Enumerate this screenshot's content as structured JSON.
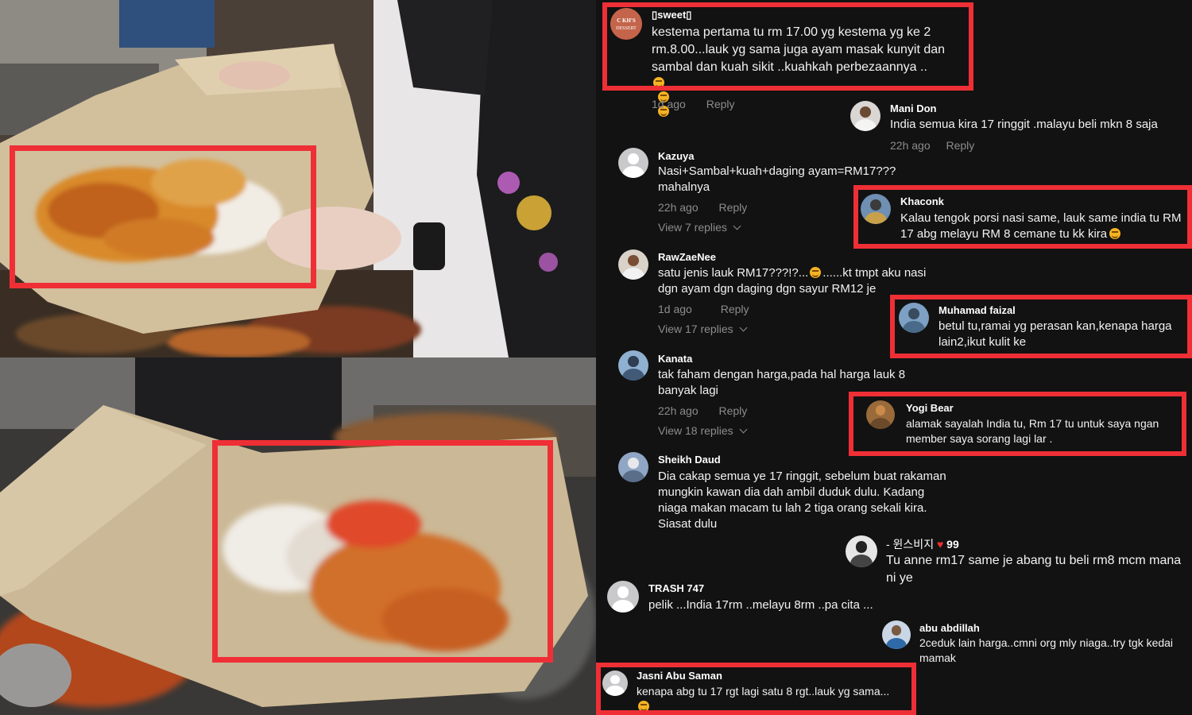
{
  "colors": {
    "highlight": "#ef2f36",
    "panel_bg": "#121212",
    "muted_text": "#8c8c8c"
  },
  "comments": [
    {
      "user": "⁠sweet⁠",
      "display_user": "▯sweet▯",
      "text": "kestema pertama tu rm 17.00 yg kestema yg ke 2 rm.8.00...lauk yg sama juga ayam masak kunyit dan sambal dan kuah sikit ..kuahkah perbezaannya ..",
      "time": "1d ago",
      "reply": "Reply",
      "avatar_icon": "dessert-logo-icon"
    },
    {
      "user": "Mani Don",
      "text": "India semua kira 17 ringgit .malayu beli mkn 8 saja",
      "time": "22h ago",
      "reply": "Reply"
    },
    {
      "user": "Kazuya",
      "text": "Nasi+Sambal+kuah+daging ayam=RM17??? mahalnya",
      "time": "22h ago",
      "reply": "Reply",
      "view": "View 7 replies"
    },
    {
      "user": "Khaconk",
      "text": "Kalau tengok porsi nasi same, lauk same india tu RM 17 abg melayu RM 8 cemane tu kk kira"
    },
    {
      "user": "RawZaeNee",
      "text_a": "satu jenis lauk RM17???!?...",
      "text_b": "......kt tmpt aku nasi dgn ayam dgn daging dgn sayur RM12 je",
      "time": "1d ago",
      "reply": "Reply",
      "view": "View 17 replies"
    },
    {
      "user": "Muhamad faizal",
      "text": "betul tu,ramai yg perasan kan,kenapa harga lain2,ikut kulit ke"
    },
    {
      "user": "Kanata",
      "text": "tak faham dengan harga,pada hal harga lauk 8 banyak lagi",
      "time": "22h ago",
      "reply": "Reply",
      "view": "View 18 replies"
    },
    {
      "user": "Yogi Bear",
      "text": "alamak sayalah India tu, Rm 17 tu untuk saya ngan member saya sorang lagi lar ."
    },
    {
      "user": "Sheikh Daud",
      "text": "Dia cakap semua ye 17 ringgit, sebelum buat rakaman mungkin kawan dia dah ambil duduk dulu. Kadang niaga makan macam tu lah 2 tiga orang sekali kira. Siasat dulu"
    },
    {
      "user": "- 윈스비지",
      "user_suffix": "99",
      "text": "Tu anne rm17 same je abang tu beli rm8 mcm mana ni ye"
    },
    {
      "user": "TRASH 747",
      "text": "pelik ...India 17rm ..melayu 8rm ..pa cita ..."
    },
    {
      "user": "abu abdillah",
      "text": "2ceduk lain harga..cmni org mly niaga..try tgk kedai mamak"
    },
    {
      "user": "Jasni Abu Saman",
      "text": "kenapa abg tu 17 rgt lagi satu 8 rgt..lauk yg sama..."
    }
  ]
}
